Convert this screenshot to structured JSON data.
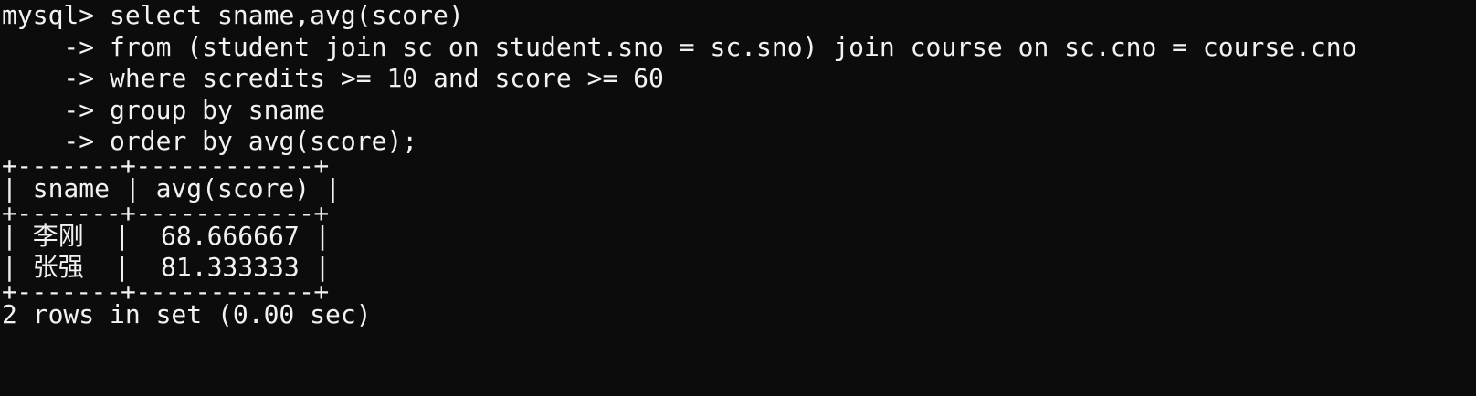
{
  "terminal": {
    "prompt": "mysql> ",
    "continuation": "    -> ",
    "query_lines": [
      "select sname,avg(score)",
      "from (student join sc on student.sno = sc.sno) join course on sc.cno = course.cno",
      "where scredits >= 10 and score >= 60",
      "group by sname",
      "order by avg(score);"
    ],
    "table": {
      "border": "+-------+------------+",
      "header_row": "| sname | avg(score) |",
      "rows": [
        "| 李刚  |  68.666667 |",
        "| 张强  |  81.333333 |"
      ]
    },
    "summary": "2 rows in set (0.00 sec)"
  },
  "colors": {
    "background": "#0c0c0c",
    "foreground": "#f2f2f2"
  }
}
